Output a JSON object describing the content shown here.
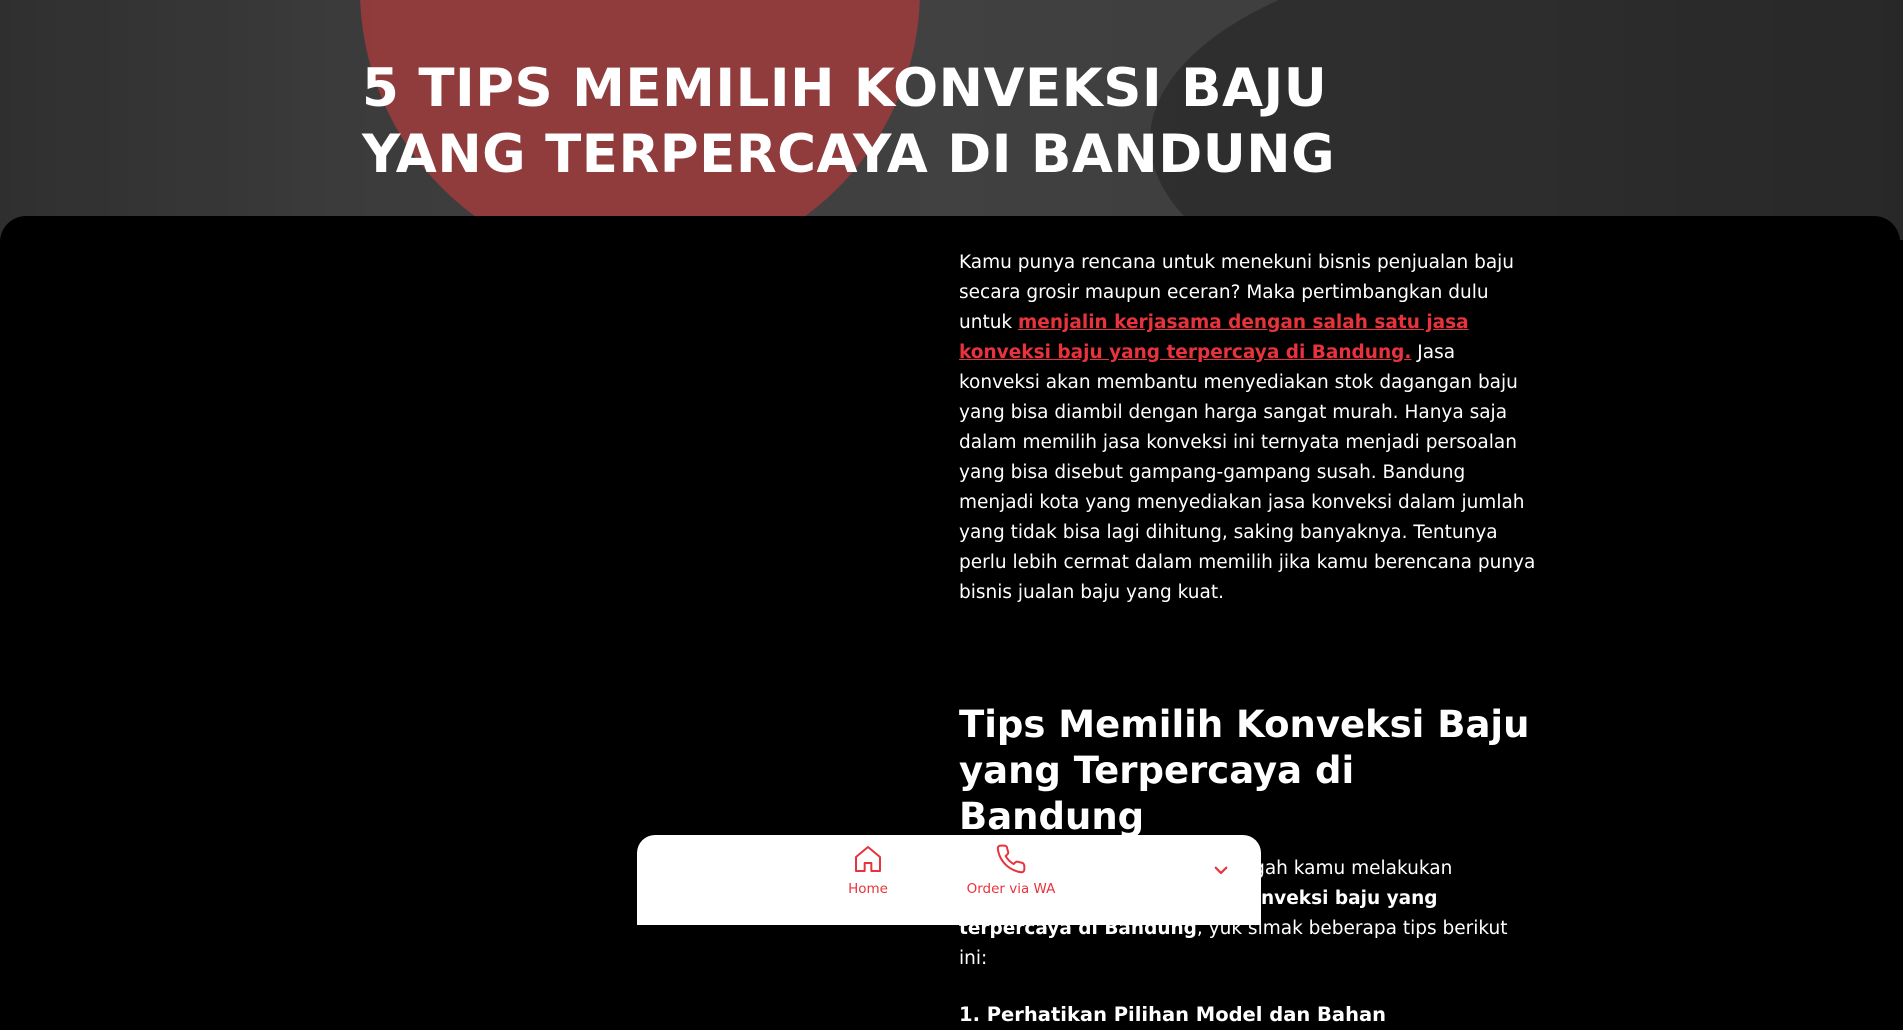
{
  "hero": {
    "title": "5 TIPS MEMILIH KONVEKSI BAJU YANG TERPERCAYA DI BANDUNG"
  },
  "article": {
    "intro_part1": "Kamu punya rencana untuk menekuni bisnis penjualan baju secara grosir maupun eceran? Maka pertimbangkan dulu untuk ",
    "intro_link": "menjalin kerjasama dengan salah satu jasa konveksi baju yang terpercaya di Bandung.",
    "intro_part2": " Jasa konveksi akan membantu menyediakan stok dagangan baju yang bisa diambil dengan harga sangat murah. Hanya saja dalam memilih jasa konveksi ini ternyata menjadi persoalan yang bisa disebut gampang-gampang susah. Bandung menjadi kota yang menyediakan jasa konveksi dalam jumlah yang tidak bisa lagi dihitung, saking banyaknya. Tentunya perlu lebih cermat dalam memilih jika kamu berencana punya bisnis jualan baju yang kuat.",
    "heading": "Tips Memilih Konveksi Baju yang Terpercaya di Bandung",
    "para_part1": "Artikel ini secara khusus mencegah kamu melakukan kesalahan pada saat memilih ",
    "para_bold": "konveksi baju yang terpercaya di Bandung",
    "para_part2": ", yuk simak beberapa tips berikut ini:",
    "subheading": "1. Perhatikan Pilihan Model dan Bahan"
  },
  "bottom_nav": {
    "home_label": "Home",
    "order_label": "Order via WA",
    "accent_color": "#e8333d",
    "icons": [
      "home-icon",
      "phone-icon",
      "chevron-down-icon"
    ]
  }
}
